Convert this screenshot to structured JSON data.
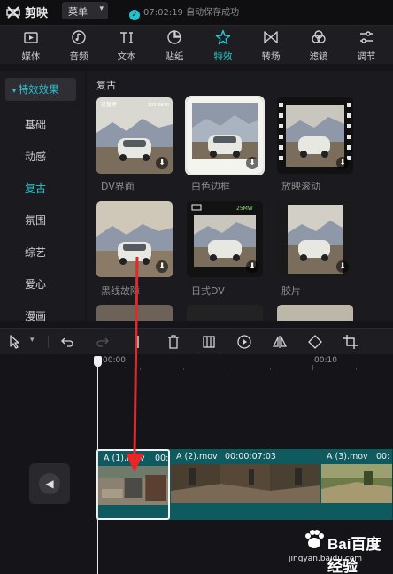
{
  "app": {
    "name": "剪映",
    "menu_label": "菜单",
    "save_status": "07:02:19 自动保存成功"
  },
  "toolbar": {
    "active_color": "#2bc6cf",
    "tabs": [
      {
        "label": "媒体",
        "icon": "media-icon"
      },
      {
        "label": "音频",
        "icon": "audio-icon"
      },
      {
        "label": "文本",
        "icon": "text-icon"
      },
      {
        "label": "贴纸",
        "icon": "sticker-icon"
      },
      {
        "label": "特效",
        "icon": "effects-icon",
        "active": true
      },
      {
        "label": "转场",
        "icon": "transition-icon"
      },
      {
        "label": "滤镜",
        "icon": "filter-icon"
      },
      {
        "label": "调节",
        "icon": "adjust-icon"
      }
    ]
  },
  "categories": {
    "header": "特效效果",
    "items": [
      "基础",
      "动感",
      "复古",
      "氛围",
      "综艺",
      "爱心",
      "漫画"
    ],
    "active": "复古"
  },
  "effects": {
    "section_title": "复古",
    "items": [
      {
        "label": "DV界面",
        "overlay_text_left": "已暂停",
        "overlay_text_right": "100-0870"
      },
      {
        "label": "白色边框",
        "selected": true
      },
      {
        "label": "放映滚动"
      },
      {
        "label": "黑线故障"
      },
      {
        "label": "日式DV",
        "overlay_text_right": "25MW"
      },
      {
        "label": "胶片"
      }
    ]
  },
  "timeline": {
    "ruler_labels": [
      "00:00",
      "00:10"
    ],
    "clips": [
      {
        "name": "A (1).mov",
        "time": "00:"
      },
      {
        "name": "A (2).mov",
        "time": "00:00:07:03"
      },
      {
        "name": "A (3).mov",
        "time": "00:"
      }
    ]
  },
  "watermark": {
    "brand": "Bai百度 经验",
    "url": "jingyan.baidu.com"
  }
}
